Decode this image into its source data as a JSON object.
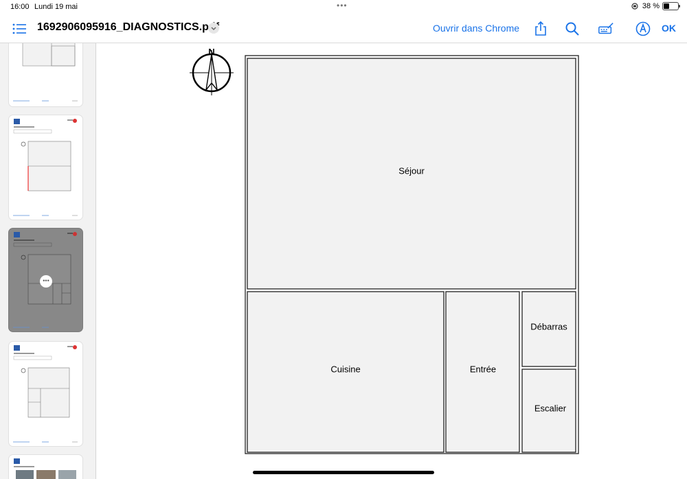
{
  "status_bar": {
    "time": "16:00",
    "date": "Lundi 19 mai",
    "battery": "38 %",
    "battery_level": 0.38
  },
  "toolbar": {
    "document_title": "1692906095916_DIAGNOSTICS.pdf",
    "open_in_chrome": "Ouvrir dans Chrome",
    "ok": "OK",
    "icons": [
      "list-icon",
      "chevron-down-icon",
      "share-icon",
      "search-icon",
      "markup-icon",
      "pen-icon"
    ]
  },
  "colors": {
    "accent": "#1a73e8"
  },
  "floor_plan": {
    "rooms": [
      {
        "id": "sejour",
        "label": "Séjour"
      },
      {
        "id": "cuisine",
        "label": "Cuisine"
      },
      {
        "id": "entree",
        "label": "Entrée"
      },
      {
        "id": "debarras",
        "label": "Débarras"
      },
      {
        "id": "escalier",
        "label": "Escalier"
      }
    ],
    "compass_letter": "N"
  },
  "thumbnails": {
    "count": 5,
    "selected_index": 2
  }
}
